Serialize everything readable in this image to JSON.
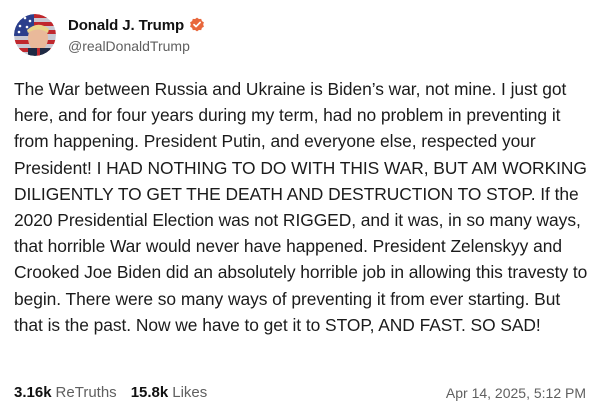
{
  "author": {
    "display_name": "Donald J. Trump",
    "handle": "@realDonaldTrump",
    "verified": true,
    "verified_color": "#e8673c",
    "avatar_icon": "profile-photo-flag"
  },
  "post": {
    "text": "The War between Russia and Ukraine is Biden’s war, not mine. I just got here, and for four years during my term, had no problem in preventing it from happening. President Putin, and everyone else, respected your President! I HAD NOTHING TO DO WITH THIS WAR, BUT AM WORKING DILIGENTLY TO GET THE DEATH AND DESTRUCTION TO STOP. If the 2020 Presidential Election was not RIGGED, and it was, in so many ways, that horrible War would never have happened. President Zelenskyy and Crooked Joe Biden did an absolutely horrible job in allowing this travesty to begin. There were so many ways of preventing it from ever starting. But that is the past. Now we have to get it to STOP, AND FAST. SO SAD!"
  },
  "stats": {
    "retruths_count": "3.16k",
    "retruths_label": "ReTruths",
    "likes_count": "15.8k",
    "likes_label": "Likes"
  },
  "timestamp": "Apr 14, 2025, 5:12 PM"
}
